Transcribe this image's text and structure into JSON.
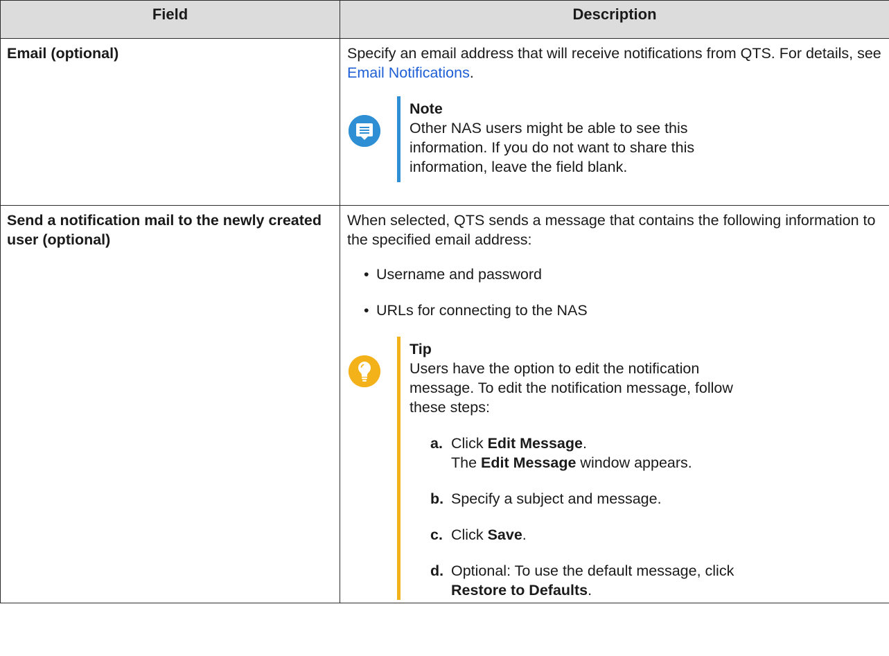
{
  "table": {
    "headers": [
      "Field",
      "Description"
    ],
    "rows": [
      {
        "field": "Email (optional)",
        "desc_pre": "Specify an email address that will receive notifications from QTS. For details, see ",
        "desc_link": "Email Notifications",
        "desc_post": ".",
        "callout": {
          "icon": "note-icon",
          "title": "Note",
          "text": "Other NAS users might be able to see this information. If you do not want to share this information, leave the field blank."
        }
      },
      {
        "field": "Send a notification mail to the newly created user (optional)",
        "desc": "When selected, QTS sends a message that contains the following information to the specified email address:",
        "bullets": [
          "Username and password",
          "URLs for connecting to the NAS"
        ],
        "callout": {
          "icon": "tip-icon",
          "title": "Tip",
          "text": "Users have the option to edit the notification message. To edit the notification message, follow these steps:",
          "steps": [
            {
              "marker": "a.",
              "pre": "Click ",
              "bold": "Edit Message",
              "post": ".",
              "sub_pre": "The ",
              "sub_bold": "Edit Message",
              "sub_post": " window appears."
            },
            {
              "marker": "b.",
              "text": "Specify a subject and message."
            },
            {
              "marker": "c.",
              "pre": "Click ",
              "bold": "Save",
              "post": "."
            },
            {
              "marker": "d.",
              "pre": "Optional: To use the default message, click ",
              "bold": "Restore to Defaults",
              "post": "."
            }
          ]
        }
      }
    ]
  },
  "colors": {
    "header_bg": "#dcdcdc",
    "link": "#1f5fd6",
    "note_accent": "#2f8fd5",
    "tip_accent": "#f4b21a"
  }
}
